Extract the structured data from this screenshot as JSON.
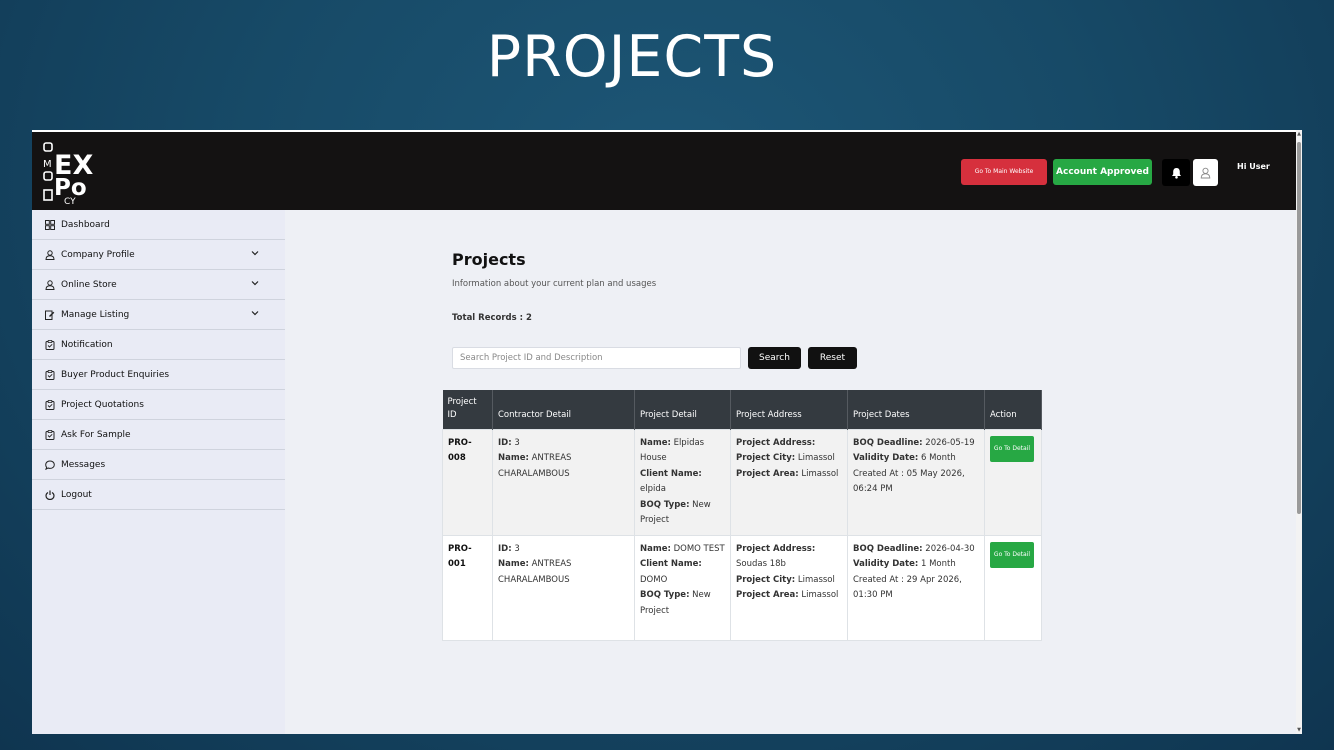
{
  "slide": {
    "title": "PROJECTS"
  },
  "header": {
    "main_website_label": "Go To Main Website",
    "account_status_label": "Account Approved",
    "greeting": "Hi User",
    "logo_letters": {
      "vertical": "DOMO",
      "big_ex": "EX",
      "big_po": "Po",
      "cy": "CY"
    }
  },
  "sidebar": {
    "items": [
      {
        "label": "Dashboard",
        "icon": "grid-icon",
        "expandable": false
      },
      {
        "label": "Company Profile",
        "icon": "user-icon",
        "expandable": true
      },
      {
        "label": "Online Store",
        "icon": "user-icon",
        "expandable": true
      },
      {
        "label": "Manage Listing",
        "icon": "edit-icon",
        "expandable": true
      },
      {
        "label": "Notification",
        "icon": "clipboard-icon",
        "expandable": false
      },
      {
        "label": "Buyer Product Enquiries",
        "icon": "clipboard-icon",
        "expandable": false
      },
      {
        "label": "Project Quotations",
        "icon": "clipboard-icon",
        "expandable": false
      },
      {
        "label": "Ask For Sample",
        "icon": "clipboard-icon",
        "expandable": false
      },
      {
        "label": "Messages",
        "icon": "chat-icon",
        "expandable": false
      },
      {
        "label": "Logout",
        "icon": "power-icon",
        "expandable": false
      }
    ]
  },
  "main": {
    "title": "Projects",
    "subtitle": "Information about your current plan and usages",
    "total_records": "Total Records : 2",
    "search": {
      "placeholder": "Search Project ID and Description",
      "value": ""
    },
    "search_label": "Search",
    "reset_label": "Reset",
    "table": {
      "headers": [
        "Project ID",
        "Contractor Detail",
        "Project Detail",
        "Project Address",
        "Project Dates",
        "Action"
      ],
      "labels": {
        "id": "ID:",
        "name": "Name:",
        "client_name": "Client Name:",
        "boq_type": "BOQ Type:",
        "project_address": "Project Address:",
        "project_city": "Project City:",
        "project_area": "Project Area:",
        "boq_deadline": "BOQ Deadline:",
        "validity_date": "Validity Date:"
      },
      "rows": [
        {
          "project_id": "PRO-008",
          "contractor_id": "3",
          "contractor_name": "ANTREAS CHARALAMBOUS",
          "project_name": "Elpidas House",
          "client_name": "elpida",
          "boq_type": "New Project",
          "address": "",
          "city": "Limassol",
          "area": "Limassol",
          "boq_deadline": "2026-05-19",
          "validity": "6 Month",
          "created": "Created At : 05 May 2026, 06:24 PM",
          "action": "Go To Detail"
        },
        {
          "project_id": "PRO-001",
          "contractor_id": "3",
          "contractor_name": "ANTREAS CHARALAMBOUS",
          "project_name": "DOMO TEST",
          "client_name": "DOMO",
          "boq_type": "New Project",
          "address": "Soudas 18b",
          "city": "Limassol",
          "area": "Limassol",
          "boq_deadline": "2026-04-30",
          "validity": "1 Month",
          "created": "Created At : 29 Apr 2026, 01:30 PM",
          "action": "Go To Detail"
        }
      ]
    }
  },
  "colors": {
    "header_bg": "#141212",
    "main_button": "#d6303d",
    "approved": "#27a844",
    "table_header": "#343a40",
    "sidebar_bg": "#e9ebf5"
  }
}
